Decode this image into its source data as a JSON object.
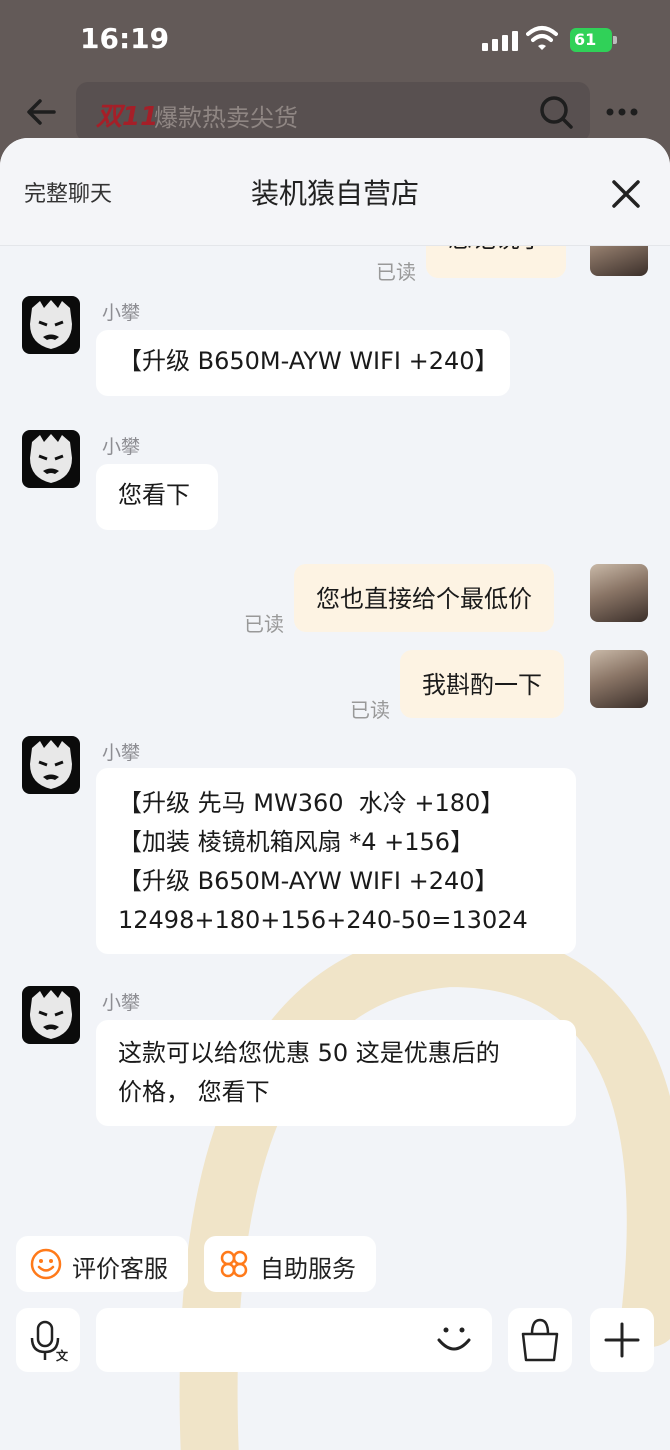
{
  "status_bar": {
    "time": "16:19",
    "battery": "61"
  },
  "background_page": {
    "search_logo": "双11",
    "search_text": "爆款热卖尖货"
  },
  "header": {
    "full_chat_label": "完整聊天",
    "title": "装机猿自营店"
  },
  "messages": [
    {
      "side": "out",
      "text": "您记说了",
      "status": "已读"
    },
    {
      "side": "in",
      "sender": "小攀",
      "text": "【升级 B650M-AYW WIFI +240】"
    },
    {
      "side": "in",
      "sender": "小攀",
      "text": "您看下"
    },
    {
      "side": "out",
      "text": "您也直接给个最低价",
      "status": "已读"
    },
    {
      "side": "out",
      "text": "我斟酌一下",
      "status": "已读"
    },
    {
      "side": "in",
      "sender": "小攀",
      "text": "【升级 先马 MW360  水冷 +180】\n【加装 棱镜机箱风扇 *4 +156】\n【升级 B650M-AYW WIFI +240】\n12498+180+156+240-50=13024"
    },
    {
      "side": "in",
      "sender": "小攀",
      "text": "这款可以给您优惠 50 这是优惠后的\n价格， 您看下"
    }
  ],
  "quick_actions": [
    {
      "label": "评价客服",
      "icon": "smile-face-icon"
    },
    {
      "label": "自助服务",
      "icon": "self-service-icon"
    }
  ],
  "input": {
    "placeholder": ""
  },
  "colors": {
    "accent": "#ff7a1a",
    "out_bubble": "#fdf3e3",
    "in_bubble": "#ffffff",
    "battery": "#30d158"
  }
}
